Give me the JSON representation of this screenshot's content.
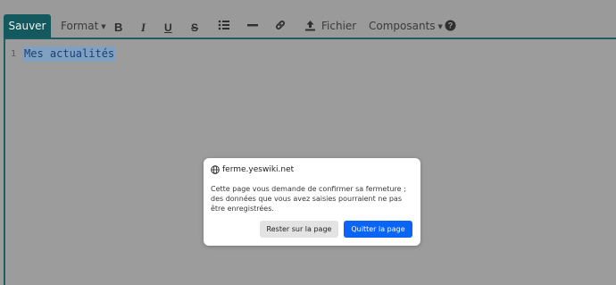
{
  "toolbar": {
    "save_label": "Sauver",
    "format_label": "Format",
    "file_label": "Fichier",
    "components_label": "Composants",
    "accent_color": "#14595e",
    "icons": [
      "bold-icon",
      "italic-icon",
      "underline-icon",
      "strikethrough-icon",
      "list-icon",
      "horizontal-rule-icon",
      "link-icon",
      "upload-icon",
      "help-icon"
    ]
  },
  "editor": {
    "line_number": "1",
    "line_text": "Mes actualités"
  },
  "dialog": {
    "title": "ferme.yeswiki.net",
    "message": "Cette page vous demande de confirmer sa fermeture ; des données que vous avez saisies pourraient ne pas être enregistrées.",
    "stay_label": "Rester sur la page",
    "leave_label": "Quitter la page",
    "primary_color": "#0a64f5"
  }
}
